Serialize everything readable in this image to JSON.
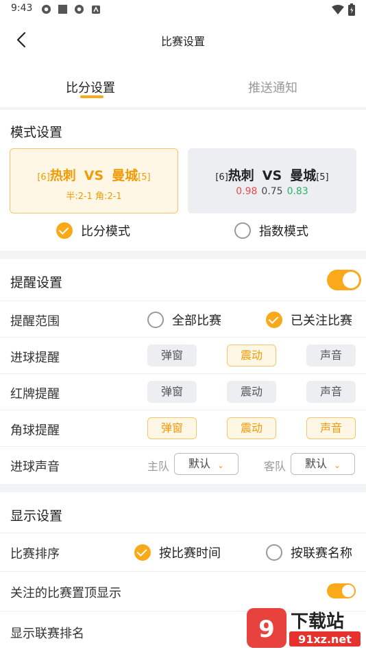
{
  "status_bar": {
    "time": "9:43"
  },
  "nav": {
    "title": "比赛设置"
  },
  "tabs": [
    {
      "label": "比分设置",
      "active": true
    },
    {
      "label": "推送通知",
      "active": false
    }
  ],
  "mode_settings": {
    "title": "模式设置",
    "score_card": {
      "home_rank": "[6]",
      "home": "热刺",
      "vs": "VS",
      "away": "曼城",
      "away_rank": "[5]",
      "detail": "半:2-1  角:2-1"
    },
    "odds_card": {
      "home_rank": "[6]",
      "home": "热刺",
      "vs": "VS",
      "away": "曼城",
      "away_rank": "[5]",
      "odd1": "0.98",
      "odd2": "0.75",
      "odd3": "0.83"
    },
    "options": [
      {
        "label": "比分模式",
        "selected": true
      },
      {
        "label": "指数模式",
        "selected": false
      }
    ]
  },
  "reminder": {
    "title": "提醒设置",
    "enabled": true,
    "scope": {
      "label": "提醒范围",
      "options": [
        {
          "label": "全部比赛",
          "selected": false
        },
        {
          "label": "已关注比赛",
          "selected": true
        }
      ]
    },
    "goal": {
      "label": "进球提醒",
      "popup": "弹窗",
      "vibrate": "震动",
      "sound": "声音"
    },
    "red_card": {
      "label": "红牌提醒",
      "popup": "弹窗",
      "vibrate": "震动",
      "sound": "声音"
    },
    "corner": {
      "label": "角球提醒",
      "popup": "弹窗",
      "vibrate": "震动",
      "sound": "声音"
    },
    "goal_sound": {
      "label": "进球声音",
      "home_label": "主队",
      "home_value": "默认",
      "away_label": "客队",
      "away_value": "默认"
    }
  },
  "display": {
    "title": "显示设置",
    "sort": {
      "label": "比赛排序",
      "options": [
        {
          "label": "按比赛时间",
          "selected": true
        },
        {
          "label": "按联赛名称",
          "selected": false
        }
      ]
    },
    "pin_followed": {
      "label": "关注的比赛置顶显示",
      "enabled": true
    },
    "show_rank": {
      "label": "显示联赛排名"
    }
  },
  "watermark": {
    "text": "下载站",
    "domain": "91xz.net"
  },
  "colors": {
    "accent": "#f9a91a",
    "accent_text": "#f29a05",
    "odd_red": "#e84b4b",
    "odd_green": "#2ab36b"
  }
}
